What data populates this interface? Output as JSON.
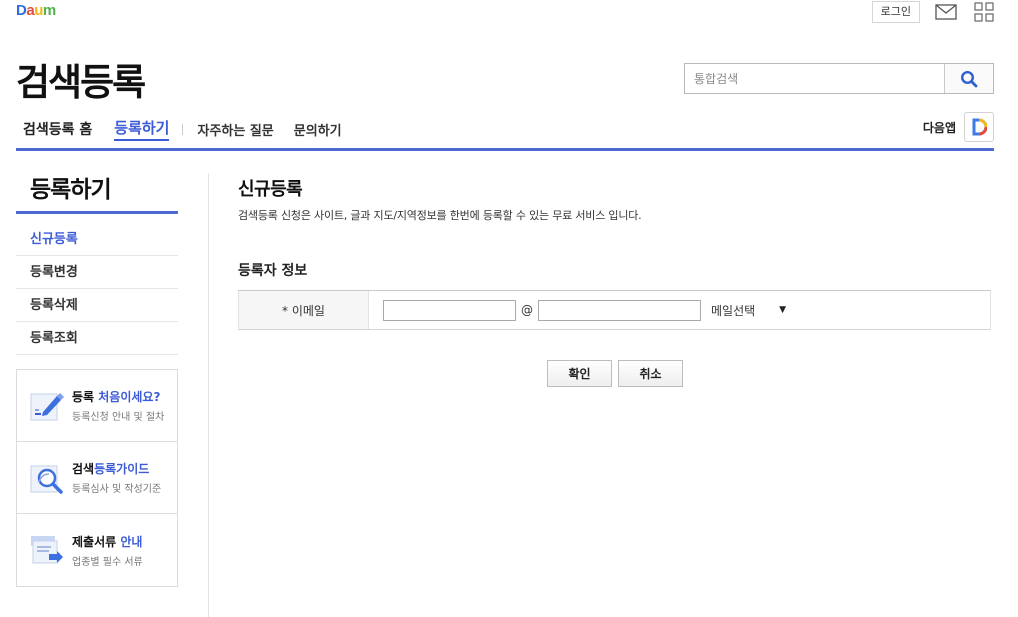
{
  "header": {
    "logo_letters": [
      {
        "char": "D",
        "color": "#2b6ee6"
      },
      {
        "char": "a",
        "color": "#e34b3c"
      },
      {
        "char": "u",
        "color": "#f3b71b"
      },
      {
        "char": "m",
        "color": "#52b24a"
      }
    ],
    "login_label": "로그인",
    "mail_icon": "mail-icon",
    "apps_icon": "grid-icon"
  },
  "page": {
    "title": "검색등록"
  },
  "search": {
    "placeholder": "통합검색",
    "value": "",
    "icon": "search-icon"
  },
  "gnb": {
    "home": "검색등록 홈",
    "register": "등록하기",
    "faq": "자주하는 질문",
    "inquiry": "문의하기"
  },
  "daum_app": {
    "label": "다음앱",
    "icon": "daum-d-icon"
  },
  "lnb": {
    "title": "등록하기",
    "items": [
      {
        "label": "신규등록",
        "active": true
      },
      {
        "label": "등록변경",
        "active": false
      },
      {
        "label": "등록삭제",
        "active": false
      },
      {
        "label": "등록조회",
        "active": false
      }
    ]
  },
  "banners": [
    {
      "title_plain": "등록 ",
      "title_highlight": "처음이세요?",
      "subtitle": "등록신청 안내 및 절차",
      "icon": "pencil-document-icon"
    },
    {
      "title_plain": "검색",
      "title_highlight": "등록가이드",
      "subtitle": "등록심사 및 작성기준",
      "icon": "magnifier-document-icon"
    },
    {
      "title_plain": "제출서류 ",
      "title_highlight": "안내",
      "subtitle": "업종별 필수 서류",
      "icon": "documents-arrow-icon"
    }
  ],
  "content": {
    "title": "신규등록",
    "description": "검색등록 신청은 사이트, 글과 지도/지역정보를 한번에 등록할 수 있는 무료 서비스 입니다.",
    "section_title": "등록자 정보",
    "email_label": "* 이메일",
    "at_sign": "@",
    "email_id_value": "",
    "email_domain_value": "",
    "mail_select_label": "메일선택",
    "confirm_label": "확인",
    "cancel_label": "취소"
  },
  "colors": {
    "accent": "#3c5bd6",
    "line": "#4d6ad1"
  }
}
